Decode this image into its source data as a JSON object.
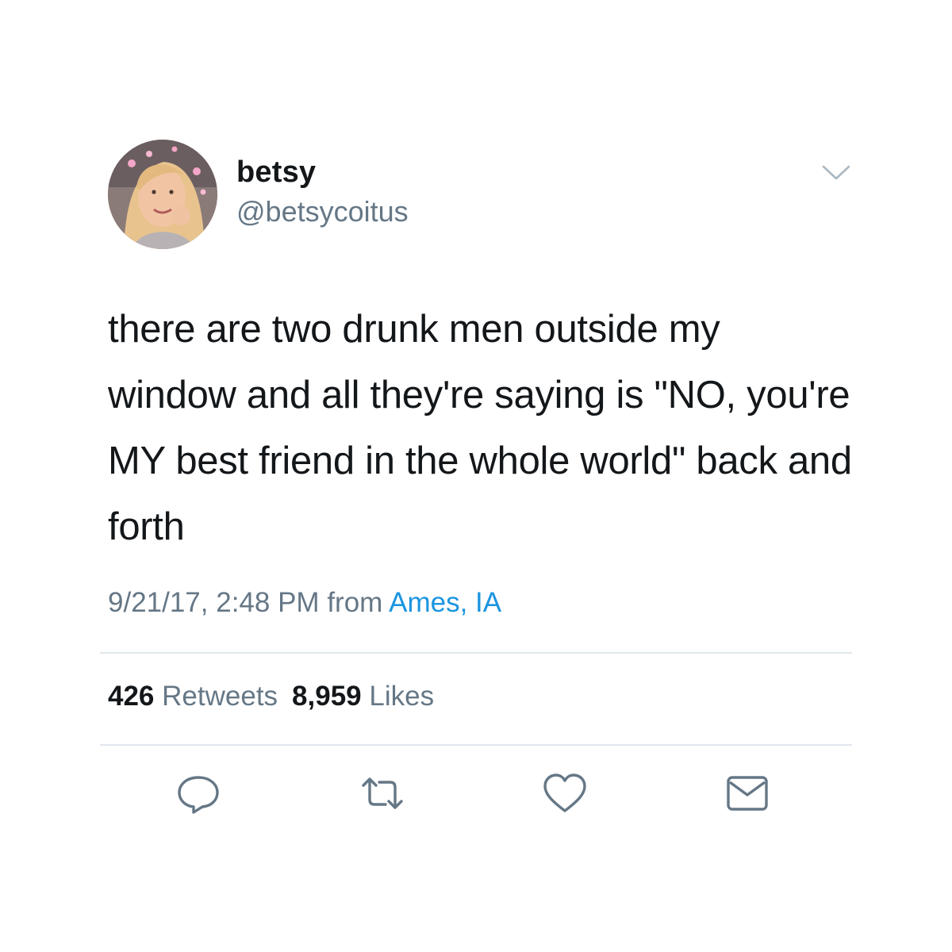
{
  "user": {
    "display_name": "betsy",
    "handle": "@betsycoitus",
    "avatar_icon": "profile-photo"
  },
  "tweet": {
    "text": "there are two drunk men outside my window and all they're saying is \"NO, you're MY best friend in the whole world\" back and forth"
  },
  "meta": {
    "timestamp": "9/21/17, 2:48 PM",
    "from_label": "from",
    "location": "Ames, IA"
  },
  "stats": {
    "retweets_count": "426",
    "retweets_label": "Retweets",
    "likes_count": "8,959",
    "likes_label": "Likes"
  },
  "actions": {
    "reply_icon": "reply-icon",
    "retweet_icon": "retweet-icon",
    "like_icon": "heart-icon",
    "dm_icon": "envelope-icon"
  },
  "colors": {
    "text": "#14171a",
    "secondary": "#657786",
    "link": "#1b95e0",
    "divider": "#e1e8ed",
    "icon": "#657786"
  }
}
